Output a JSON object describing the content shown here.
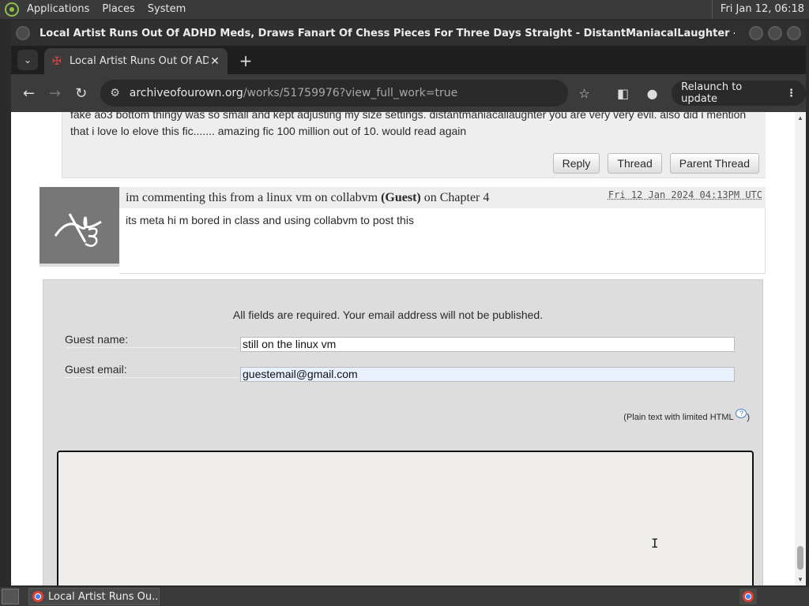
{
  "desktop": {
    "menu": [
      "Applications",
      "Places",
      "System"
    ],
    "clock": "Fri Jan 12, 06:18"
  },
  "window": {
    "title": "Local Artist Runs Out Of ADHD Meds, Draws Fanart Of Chess Pieces For Three Days Straight - DistantManiacalLaughter - The Amazing Digital..."
  },
  "browser": {
    "tab_title": "Local Artist Runs Out Of ADHD",
    "url_host": "archiveofourown.org",
    "url_path": "/works/51759976?view_full_work=true",
    "relaunch_label": "Relaunch to update"
  },
  "prev_comment": {
    "text": "fake ao3 bottom thingy was so small and kept adjusting my size settings. distantmaniacallaughter you are very very evil. also did i mention that i love lo elove this fic....... amazing fic 100 million out of 10. would read again",
    "actions": [
      "Reply",
      "Thread",
      "Parent Thread"
    ]
  },
  "comment": {
    "author": "im commenting this from a linux vm on collabvm",
    "guest_tag": "(Guest)",
    "chapter_text": "on Chapter 4",
    "date": "Fri 12 Jan 2024 04:13PM UTC",
    "body": "its meta hi m bored in class and using collabvm to post this"
  },
  "reply_form": {
    "notice": "All fields are required. Your email address will not be published.",
    "guest_name_label": "Guest name:",
    "guest_name_value": "still on the linux vm",
    "guest_email_label": "Guest email:",
    "guest_email_value": "guestemail@gmail.com",
    "html_note": "(Plain text with limited HTML",
    "html_note_close": ")",
    "help_symbol": "?"
  },
  "taskbar": {
    "task_label": "Local Artist Runs Ou..."
  }
}
